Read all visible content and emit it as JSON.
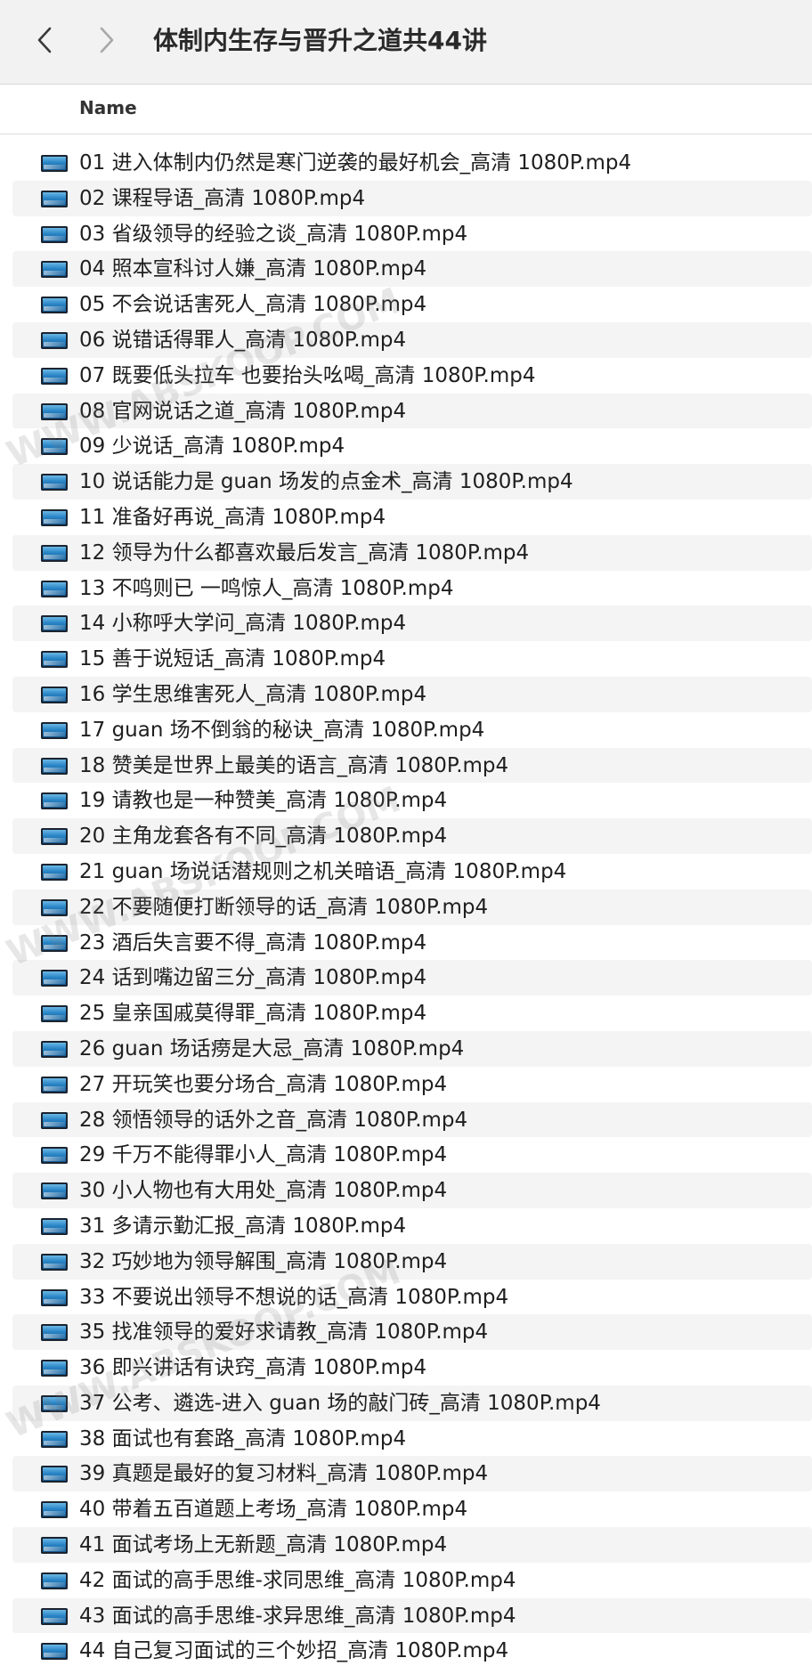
{
  "toolbar": {
    "back_icon": "chevron-left-icon",
    "forward_icon": "chevron-right-icon",
    "title": "体制内生存与晋升之道共44讲"
  },
  "columns": {
    "name": "Name"
  },
  "files": [
    "01 进入体制内仍然是寒门逆袭的最好机会_高清 1080P.mp4",
    "02 课程导语_高清 1080P.mp4",
    "03 省级领导的经验之谈_高清 1080P.mp4",
    "04 照本宣科讨人嫌_高清 1080P.mp4",
    "05 不会说话害死人_高清 1080P.mp4",
    "06 说错话得罪人_高清 1080P.mp4",
    "07 既要低头拉车 也要抬头吆喝_高清 1080P.mp4",
    "08 官网说话之道_高清 1080P.mp4",
    "09 少说话_高清 1080P.mp4",
    "10 说话能力是 guan 场发的点金术_高清 1080P.mp4",
    "11 准备好再说_高清 1080P.mp4",
    "12 领导为什么都喜欢最后发言_高清 1080P.mp4",
    "13 不鸣则已 一鸣惊人_高清 1080P.mp4",
    "14 小称呼大学问_高清 1080P.mp4",
    "15 善于说短话_高清 1080P.mp4",
    "16 学生思维害死人_高清 1080P.mp4",
    "17 guan 场不倒翁的秘诀_高清 1080P.mp4",
    "18 赞美是世界上最美的语言_高清 1080P.mp4",
    "19 请教也是一种赞美_高清 1080P.mp4",
    "20 主角龙套各有不同_高清 1080P.mp4",
    "21 guan 场说话潜规则之机关暗语_高清 1080P.mp4",
    "22 不要随便打断领导的话_高清 1080P.mp4",
    "23 酒后失言要不得_高清 1080P.mp4",
    "24 话到嘴边留三分_高清 1080P.mp4",
    "25 皇亲国戚莫得罪_高清 1080P.mp4",
    "26 guan 场话痨是大忌_高清 1080P.mp4",
    "27 开玩笑也要分场合_高清 1080P.mp4",
    "28 领悟领导的话外之音_高清 1080P.mp4",
    "29 千万不能得罪小人_高清 1080P.mp4",
    "30 小人物也有大用处_高清 1080P.mp4",
    "31 多请示勤汇报_高清 1080P.mp4",
    "32 巧妙地为领导解围_高清 1080P.mp4",
    "33 不要说出领导不想说的话_高清 1080P.mp4",
    "35 找准领导的爱好求请教_高清 1080P.mp4",
    "36 即兴讲话有诀窍_高清 1080P.mp4",
    "37 公考、遴选-进入 guan 场的敲门砖_高清 1080P.mp4",
    "38 面试也有套路_高清 1080P.mp4",
    "39 真题是最好的复习材料_高清 1080P.mp4",
    "40 带着五百道题上考场_高清 1080P.mp4",
    "41 面试考场上无新题_高清 1080P.mp4",
    "42 面试的高手思维-求同思维_高清 1080P.mp4",
    "43 面试的高手思维-求异思维_高清 1080P.mp4",
    "44 自己复习面试的三个妙招_高清 1080P.mp4"
  ],
  "file_icon": "video-file-icon",
  "watermark": "WWW.ABSKOOP.COM",
  "colors": {
    "toolbar_bg": "#f2f2f2",
    "row_alt_bg": "#f4f4f4",
    "text": "#1f1f1f"
  }
}
